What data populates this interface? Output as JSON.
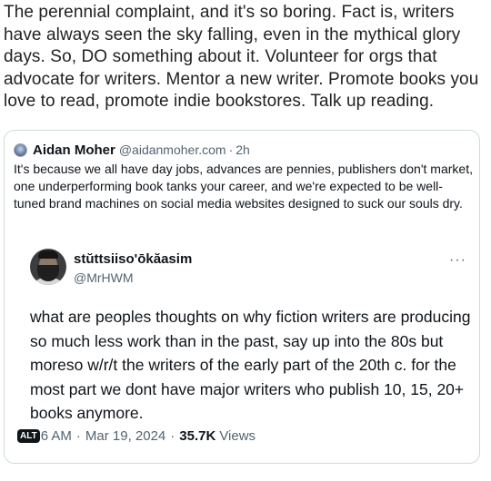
{
  "main_text": "The perennial complaint, and it's so boring. Fact is, writers have always seen the sky falling, even in the mythical glory days. So, DO something about it. Volunteer for orgs that advocate for writers. Mentor a new writer. Promote books you love to read, promote indie bookstores. Talk up reading.",
  "quote": {
    "name": "Aidan Moher",
    "handle": "@aidanmoher.com",
    "separator": "·",
    "time": "2h",
    "text": "It's because we all have day jobs, advances are pennies, publishers don't market, one underperforming book tanks your career, and we're expected to be well-tuned brand machines on social media websites designed to suck our souls dry."
  },
  "inner": {
    "name": "stŭttsiiso'ōkăasim",
    "handle": "@MrHWM",
    "more": "···",
    "text": "what are peoples thoughts on why fiction writers are producing so much less work than in the past, say up into the 80s but moreso w/r/t the writers of the early part of the 20th c. for the most part we dont have major writers who publish 10, 15, 20+ books anymore.",
    "alt": "ALT",
    "time": "6 AM",
    "separator": "·",
    "date": "Mar 19, 2024",
    "views_count": "35.7K",
    "views_label": "Views"
  }
}
